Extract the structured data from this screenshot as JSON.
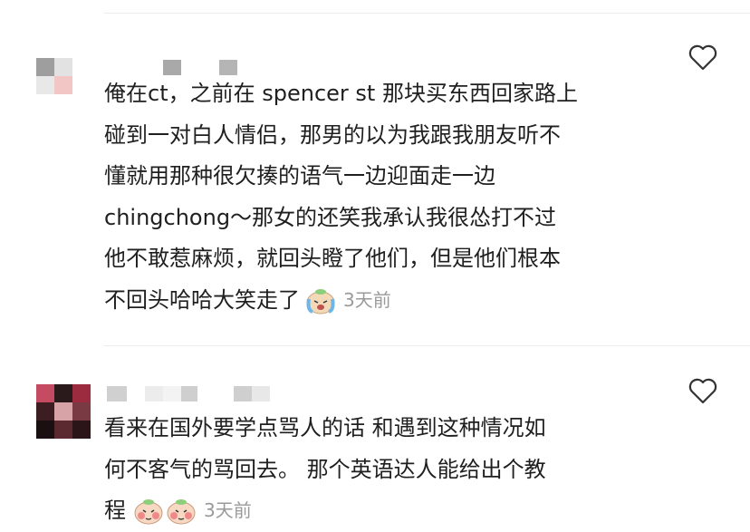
{
  "comments": [
    {
      "lines": [
        "俺在ct，之前在 spencer st 那块买东西回家路上",
        "碰到一对白人情侣，那男的以为我跟我朋友听不",
        "懂就用那种很欠揍的语气一边迎面走一边",
        "chingchong～那女的还笑我承认我很怂打不过",
        "他不敢惹麻烦，就回头瞪了他们，但是他们根本",
        "不回头哈哈大笑走了"
      ],
      "emoji": [
        "crying-face-emoji"
      ],
      "time": "3天前",
      "like_icon": "heart-icon"
    },
    {
      "lines": [
        "看来在国外要学点骂人的话 和遇到这种情况如",
        "何不客气的骂回去。 那个英语达人能给出个教",
        "程"
      ],
      "emoji": [
        "peach-cheek-emoji",
        "peach-cheek-emoji"
      ],
      "time": "3天前",
      "like_icon": "heart-icon"
    }
  ],
  "colors": {
    "text": "#1f1f1f",
    "time": "#9a9a9a",
    "divider": "#ececec",
    "icon": "#333333"
  }
}
